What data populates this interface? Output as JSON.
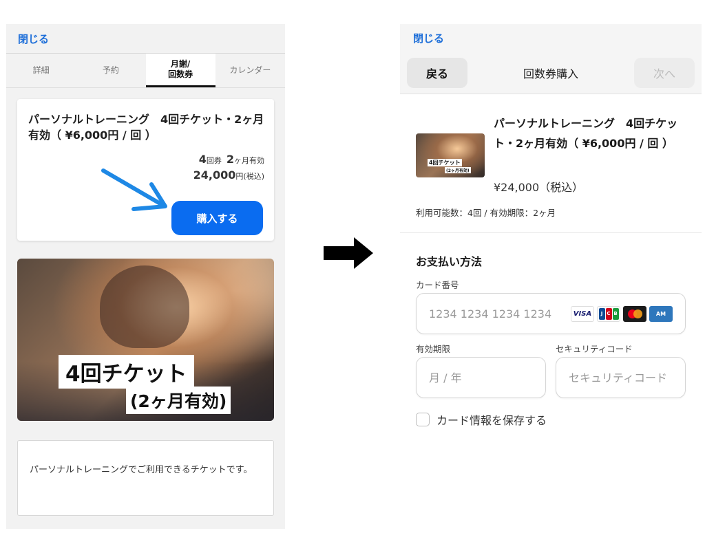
{
  "left": {
    "close_label": "閉じる",
    "tabs": [
      {
        "label": "詳細"
      },
      {
        "label": "予約"
      },
      {
        "label": "月謝/\n回数券"
      },
      {
        "label": "カレンダー"
      }
    ],
    "ticket": {
      "title": "パーソナルトレーニング　4回チケット・2ヶ月有効（ ¥6,000円 / 回 ）",
      "count_num": "4",
      "count_unit": "回券",
      "validity_num": "2",
      "validity_unit": "ヶ月有効",
      "price": "24,000",
      "price_suffix": "円(税込)",
      "buy_label": "購入する",
      "image_text_1": "4回チケット",
      "image_text_2": "(2ヶ月有効)"
    },
    "description": "パーソナルトレーニングでご利用できるチケットです。"
  },
  "right": {
    "close_label": "閉じる",
    "back_label": "戻る",
    "nav_title": "回数券購入",
    "next_label": "次へ",
    "product": {
      "thumb_text_1": "4回チケット",
      "thumb_text_2": "(2ヶ月有効)",
      "title": "パーソナルトレーニング　4回チケット・2ヶ月有効（ ¥6,000円 / 回 ）",
      "price": "¥24,000（税込）",
      "info": "利用可能数：4回 / 有効期限：2ヶ月"
    },
    "payment": {
      "heading": "お支払い方法",
      "card_number_label": "カード番号",
      "card_number_placeholder": "1234 1234 1234 1234",
      "card_brands": [
        "VISA",
        "JCB",
        "Mastercard",
        "AMEX"
      ],
      "expiry_label": "有効期限",
      "expiry_placeholder": "月 / 年",
      "cvc_label": "セキュリティコード",
      "cvc_placeholder": "セキュリティコード",
      "save_card_label": "カード情報を保存する",
      "save_card_checked": false
    }
  },
  "colors": {
    "link": "#1e6fd9",
    "buy_button": "#0a6cf0",
    "annotation_arrow": "#1e88e5"
  }
}
